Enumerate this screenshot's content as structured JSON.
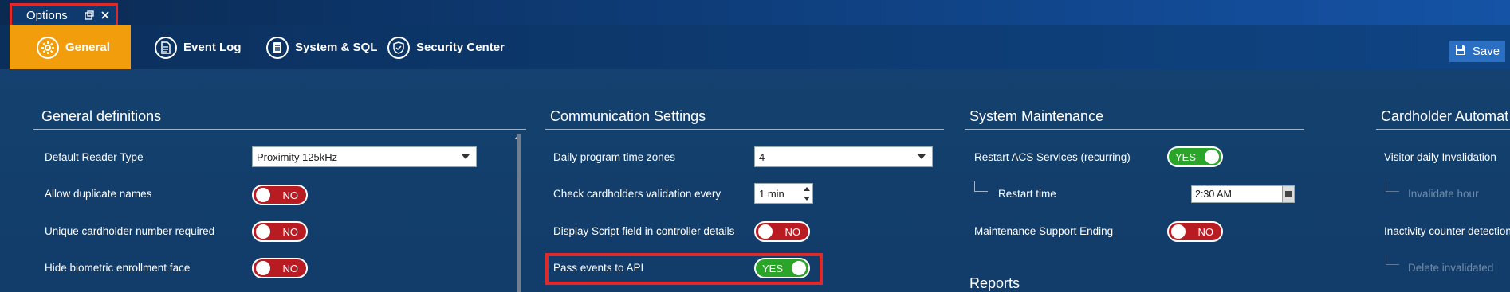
{
  "window": {
    "tab_title": "Options",
    "popout_icon": "popout-icon",
    "close_icon": "close-icon"
  },
  "nav": {
    "items": [
      {
        "label": "General",
        "icon": "gear-icon",
        "active": true
      },
      {
        "label": "Event Log",
        "icon": "document-icon",
        "active": false
      },
      {
        "label": "System & SQL",
        "icon": "server-icon",
        "active": false
      },
      {
        "label": "Security Center",
        "icon": "shield-icon",
        "active": false
      }
    ],
    "save_label": "Save",
    "save_icon": "floppy-disk-icon"
  },
  "general": {
    "title": "General definitions",
    "default_reader_type_label": "Default Reader Type",
    "default_reader_type_value": "Proximity 125kHz",
    "allow_duplicate_names_label": "Allow duplicate names",
    "allow_duplicate_names_value": "NO",
    "unique_cardholder_label": "Unique cardholder number required",
    "unique_cardholder_value": "NO",
    "hide_biometric_label": "Hide biometric enrollment face",
    "hide_biometric_value": "NO"
  },
  "communication": {
    "title": "Communication Settings",
    "daily_program_label": "Daily program time zones",
    "daily_program_value": "4",
    "check_cardholders_label": "Check cardholders validation every",
    "check_cardholders_value": "1 min",
    "display_script_label": "Display Script field in controller details",
    "display_script_value": "NO",
    "pass_events_label": "Pass events to API",
    "pass_events_value": "YES"
  },
  "maintenance": {
    "title": "System Maintenance",
    "restart_services_label": "Restart ACS Services (recurring)",
    "restart_services_value": "YES",
    "restart_time_label": "Restart time",
    "restart_time_value": "2:30 AM",
    "support_ending_label": "Maintenance Support Ending",
    "support_ending_value": "NO",
    "reports_title": "Reports"
  },
  "cardholder_automation": {
    "title": "Cardholder Automat",
    "visitor_invalidation_label": "Visitor daily Invalidation",
    "invalidate_hour_label": "Invalidate hour",
    "inactivity_label": "Inactivity counter detection",
    "delete_invalidated_label": "Delete invalidated"
  },
  "colors": {
    "accent_orange": "#f29d0c",
    "toggle_no": "#b81c22",
    "toggle_yes": "#2aa52a",
    "highlight_red": "#e02a2a"
  }
}
